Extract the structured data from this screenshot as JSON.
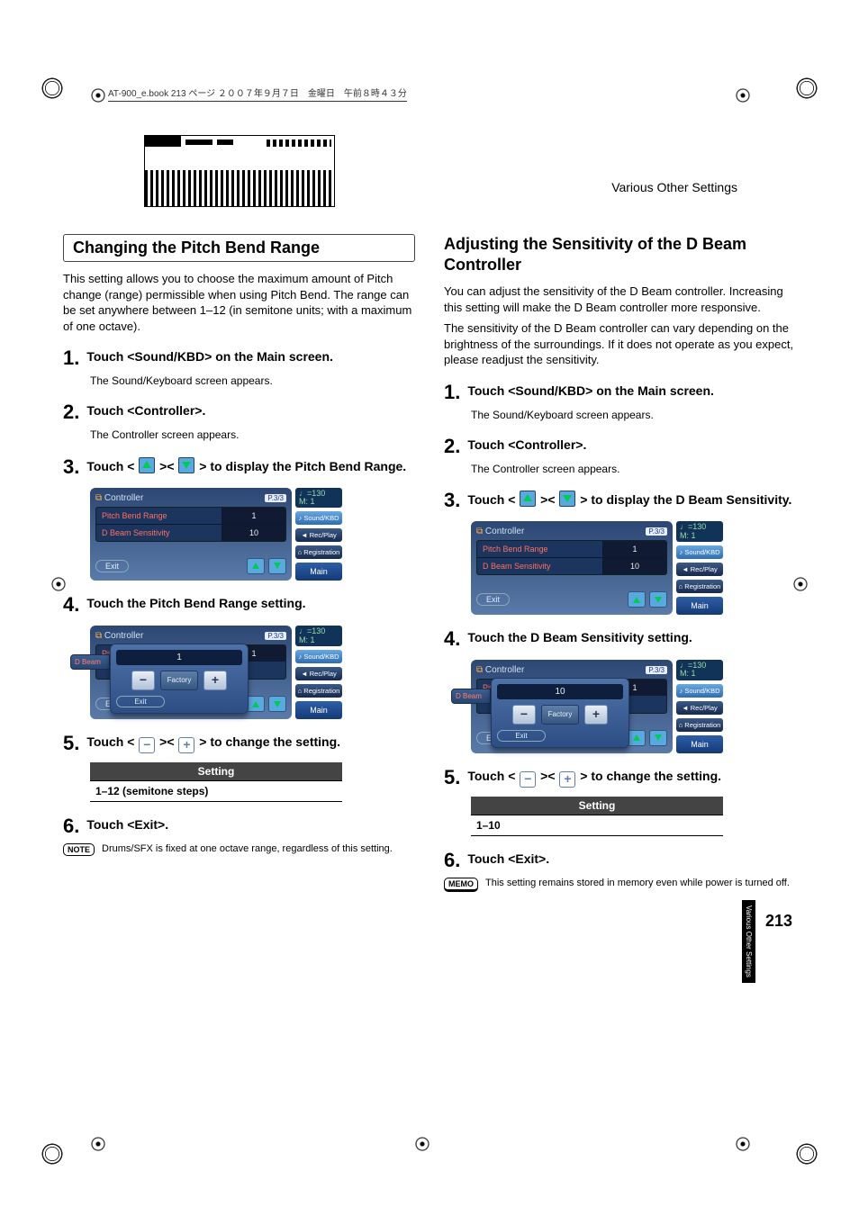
{
  "book_info": "AT-900_e.book 213 ページ ２００７年９月７日　金曜日　午前８時４３分",
  "header_right": "Various Other Settings",
  "side_tab": "Various Other Settings",
  "page_number": "213",
  "left": {
    "title": "Changing the Pitch Bend Range",
    "intro": "This setting allows you to choose the maximum amount of Pitch change (range) permissible when using Pitch Bend. The range can be set anywhere between 1–12 (in semitone units; with a maximum of one octave).",
    "steps": {
      "s1": "Touch <Sound/KBD> on the Main screen.",
      "s1b": "The Sound/Keyboard screen appears.",
      "s2": "Touch <Controller>.",
      "s2b": "The Controller screen appears.",
      "s3a": "Touch < ",
      "s3b": " >< ",
      "s3c": " > to display the Pitch Bend Range.",
      "s4": "Touch the Pitch Bend Range setting.",
      "s5a": "Touch < ",
      "s5b": " >< ",
      "s5c": " > to change the setting.",
      "s6": "Touch <Exit>."
    },
    "setting_header": "Setting",
    "setting_value": "1–12 (semitone steps)",
    "note_tag": "NOTE",
    "note": "Drums/SFX is fixed at one octave range, regardless of this setting."
  },
  "right": {
    "title": "Adjusting the Sensitivity of the D Beam Controller",
    "intro1": "You can adjust the sensitivity of the D Beam controller. Increasing this setting will make the D Beam controller more responsive.",
    "intro2": "The sensitivity of the D Beam controller can vary depending on the brightness of the surroundings. If it does not operate as you expect, please readjust the sensitivity.",
    "steps": {
      "s1": "Touch <Sound/KBD> on the Main screen.",
      "s1b": "The Sound/Keyboard screen appears.",
      "s2": "Touch <Controller>.",
      "s2b": "The Controller screen appears.",
      "s3a": "Touch < ",
      "s3b": " >< ",
      "s3c": " > to display the D Beam Sensitivity.",
      "s4": "Touch the D Beam Sensitivity setting.",
      "s5a": "Touch < ",
      "s5b": " >< ",
      "s5c": " > to change the setting.",
      "s6": "Touch <Exit>."
    },
    "setting_header": "Setting",
    "setting_value": "1–10",
    "memo_tag": "MEMO",
    "memo": "This setting remains stored in memory even while power is turned off."
  },
  "screenshot": {
    "title": "Controller",
    "page": "P.3/3",
    "tempo_line1": "♩=130",
    "tempo_line2": "M:    1",
    "row1_label": "Pitch Bend Range",
    "row1_value": "1",
    "row2_label": "D Beam Sensitivity",
    "row2_value": "10",
    "exit": "Exit",
    "btn_soundkbd": "♪ Sound/KBD",
    "btn_recplay": "◄ Rec/Play",
    "btn_registration": "⌂ Registration",
    "btn_main": "Main",
    "pop_value_pitch": "1",
    "pop_value_dbeam": "10",
    "pop_minus": "−",
    "pop_plus": "+",
    "pop_factory": "Factory",
    "pop_exit": "Exit",
    "pop_dbeam_tab": "D Beam",
    "pop_pitch_tab_hint": "Pitch Bend Range"
  }
}
